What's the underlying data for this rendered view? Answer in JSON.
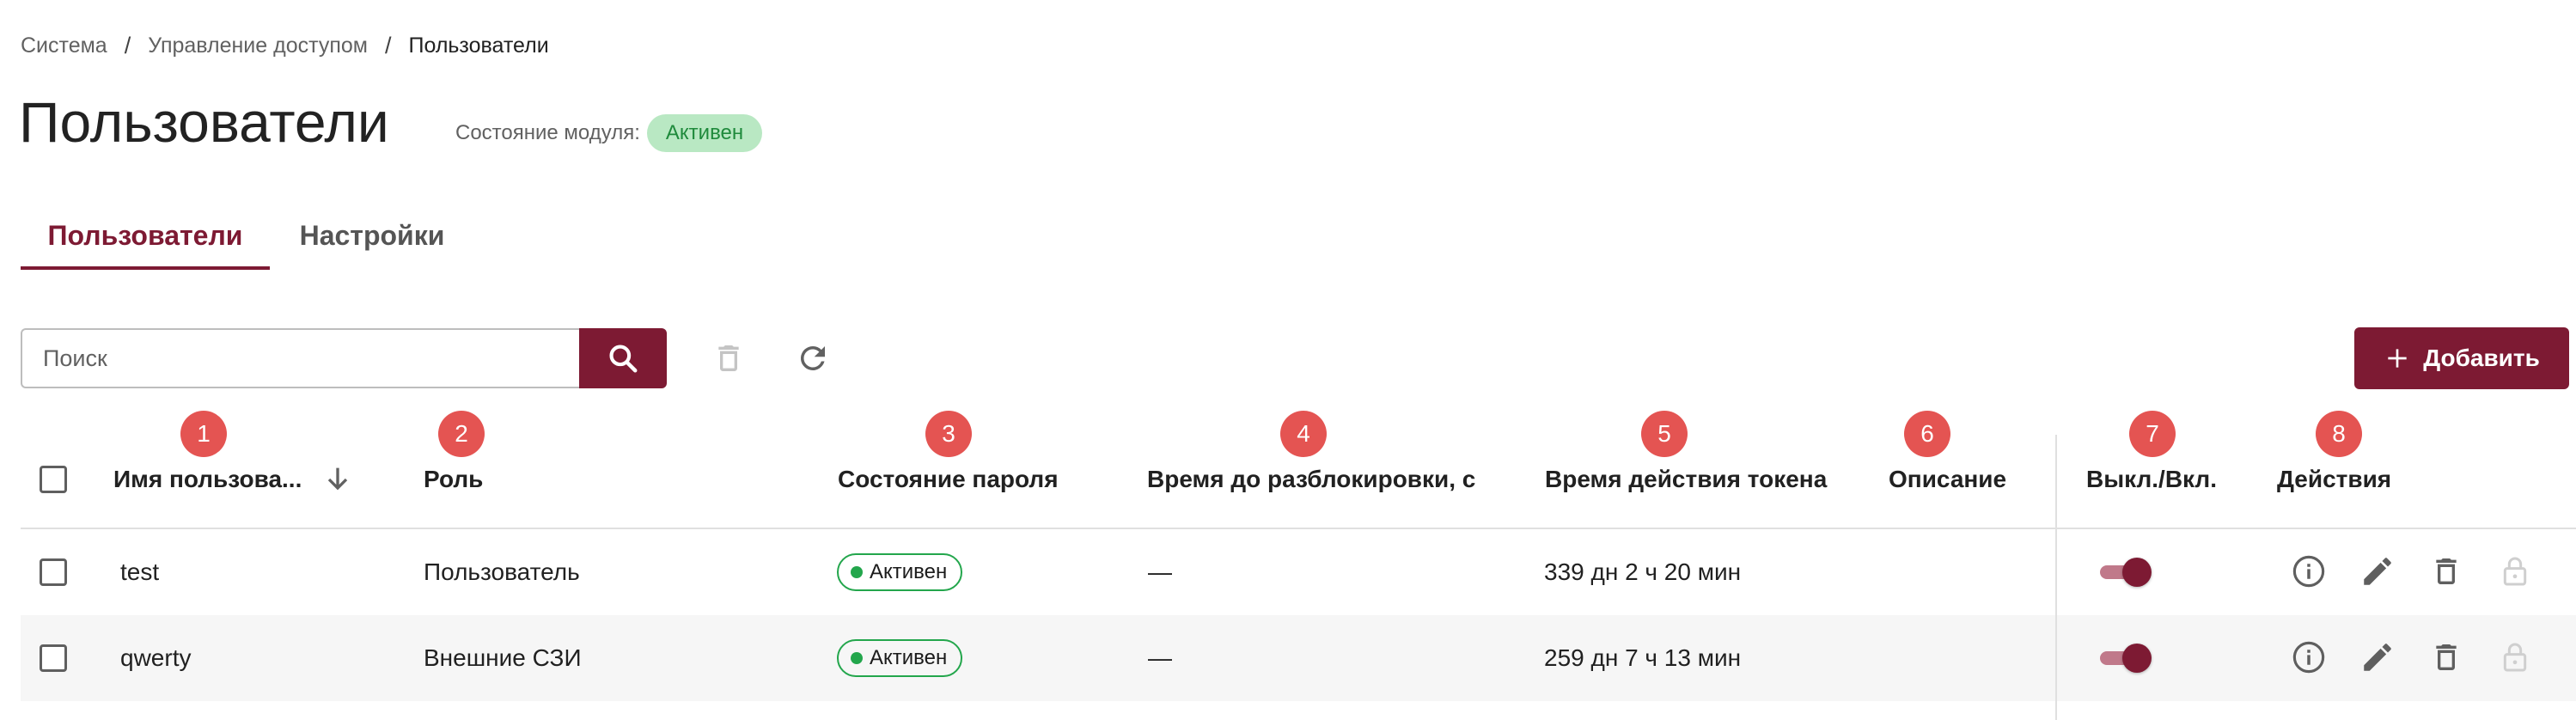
{
  "breadcrumb": {
    "items": [
      "Система",
      "Управление доступом",
      "Пользователи"
    ],
    "separator": "/"
  },
  "page": {
    "title": "Пользователи",
    "module_state_label": "Состояние модуля:",
    "module_state_value": "Активен"
  },
  "tabs": [
    {
      "label": "Пользователи",
      "active": true
    },
    {
      "label": "Настройки",
      "active": false
    }
  ],
  "toolbar": {
    "search_placeholder": "Поиск",
    "search_value": "",
    "add_label": "Добавить"
  },
  "markers": [
    "1",
    "2",
    "3",
    "4",
    "5",
    "6",
    "7",
    "8"
  ],
  "table": {
    "columns": [
      "Имя пользова...",
      "Роль",
      "Состояние пароля",
      "Время до разблокировки, с",
      "Описание",
      "Время действия токена",
      "Выкл./Вкл.",
      "Действия"
    ],
    "rows": [
      {
        "name": "test",
        "role": "Пользователь",
        "password_state": "Активен",
        "unlock_time": "—",
        "token_time": "339 дн 2 ч 20 мин",
        "description": "",
        "enabled": true
      },
      {
        "name": "qwerty",
        "role": "Внешние СЗИ",
        "password_state": "Активен",
        "unlock_time": "—",
        "token_time": "259 дн 7 ч 13 мин",
        "description": "",
        "enabled": true
      }
    ]
  },
  "colors": {
    "accent": "#7d1a33",
    "marker": "#e45452",
    "status_green": "#23a64c",
    "badge_bg": "#b9e8c3"
  },
  "icons": {
    "search": "search-icon",
    "delete": "trash-icon",
    "refresh": "refresh-icon",
    "add": "plus-icon",
    "sort": "arrow-down-icon",
    "info": "info-icon",
    "edit": "pencil-icon",
    "lock": "lock-open-icon"
  }
}
